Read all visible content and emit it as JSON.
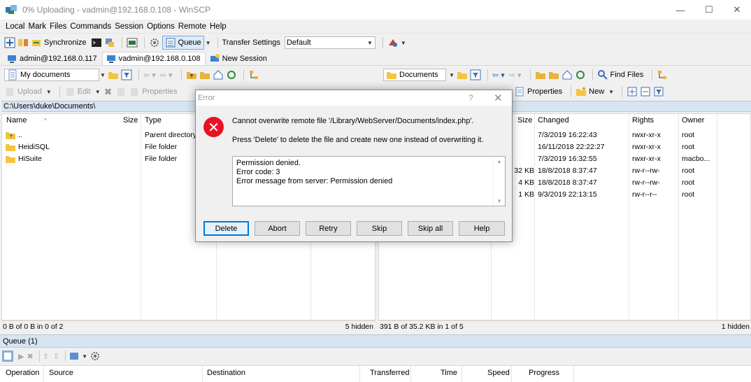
{
  "window": {
    "title": "0% Uploading - vadmin@192.168.0.108 - WinSCP",
    "minimize": "—",
    "maximize": "☐",
    "close": "✕"
  },
  "menu": [
    "Local",
    "Mark",
    "Files",
    "Commands",
    "Session",
    "Options",
    "Remote",
    "Help"
  ],
  "toolbar": {
    "synchronize": "Synchronize",
    "queue": "Queue",
    "transfer_settings_label": "Transfer Settings",
    "transfer_settings_value": "Default"
  },
  "session_tabs": [
    {
      "label": "admin@192.168.0.117"
    },
    {
      "label": "vadmin@192.168.0.108"
    },
    {
      "label": "New Session"
    }
  ],
  "left": {
    "location": "My documents",
    "ops": {
      "upload": "Upload",
      "edit": "Edit",
      "properties": "Properties"
    },
    "path": "C:\\Users\\duke\\Documents\\",
    "columns": {
      "name": "Name",
      "size": "Size",
      "type": "Type"
    },
    "rows": [
      {
        "name": "..",
        "size": "",
        "type": "Parent directory"
      },
      {
        "name": "HeidiSQL",
        "size": "",
        "type": "File folder"
      },
      {
        "name": "HiSuite",
        "size": "",
        "type": "File folder"
      }
    ],
    "status_left": "0 B of 0 B in 0 of 2",
    "status_right": "5 hidden"
  },
  "right": {
    "location": "Documents",
    "find_files": "Find Files",
    "ops": {
      "properties": "Properties",
      "new": "New"
    },
    "columns": {
      "size": "Size",
      "changed": "Changed",
      "rights": "Rights",
      "owner": "Owner"
    },
    "rows": [
      {
        "size": "",
        "changed": "7/3/2019 16:22:43",
        "rights": "rwxr-xr-x",
        "owner": "root"
      },
      {
        "size": "",
        "changed": "16/11/2018 22:22:27",
        "rights": "rwxr-xr-x",
        "owner": "root"
      },
      {
        "size": "",
        "changed": "7/3/2019 16:32:55",
        "rights": "rwxr-xr-x",
        "owner": "macbo..."
      },
      {
        "size": "32 KB",
        "changed": "18/8/2018 8:37:47",
        "rights": "rw-r--rw-",
        "owner": "root"
      },
      {
        "size": "4 KB",
        "changed": "18/8/2018 8:37:47",
        "rights": "rw-r--rw-",
        "owner": "root"
      },
      {
        "size": "1 KB",
        "changed": "9/3/2019 22:13:15",
        "rights": "rw-r--r--",
        "owner": "root"
      }
    ],
    "status_left": "391 B of 35.2 KB in 1 of 5",
    "status_right": "1 hidden"
  },
  "queue": {
    "header": "Queue (1)",
    "columns": [
      "Operation",
      "Source",
      "Destination",
      "Transferred",
      "Time",
      "Speed",
      "Progress"
    ]
  },
  "dialog": {
    "title": "Error",
    "help_glyph": "?",
    "close_glyph": "✕",
    "message1": "Cannot overwrite remote file '/Library/WebServer/Documents/index.php'.",
    "message2": "Press 'Delete' to delete the file and create new one instead of overwriting it.",
    "details": [
      "Permission denied.",
      "Error code: 3",
      "Error message from server: Permission denied"
    ],
    "buttons": [
      "Delete",
      "Abort",
      "Retry",
      "Skip",
      "Skip all",
      "Help"
    ]
  },
  "colors": {
    "error": "#e81123",
    "accent": "#0078d7",
    "folder": "#f4c542"
  }
}
